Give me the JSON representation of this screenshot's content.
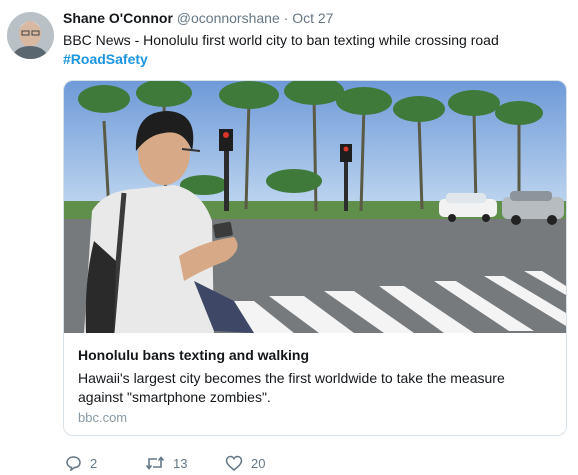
{
  "tweet": {
    "author_name": "Shane O'Connor",
    "author_handle": "@oconnorshane",
    "separator": "·",
    "date": "Oct 27",
    "text": "BBC News - Honolulu first world city to ban texting while crossing road",
    "hashtag": "#RoadSafety",
    "card": {
      "title": "Honolulu bans texting and walking",
      "description": "Hawaii's largest city becomes the first worldwide to take the measure against \"smartphone zombies\".",
      "domain": "bbc.com"
    },
    "actions": {
      "reply_count": "2",
      "retweet_count": "13",
      "like_count": "20"
    }
  },
  "icons": {
    "reply": "reply-icon",
    "retweet": "retweet-icon",
    "like": "heart-icon"
  },
  "colors": {
    "link": "#1b95e0",
    "secondary": "#657786",
    "border": "#d9e1e8"
  }
}
